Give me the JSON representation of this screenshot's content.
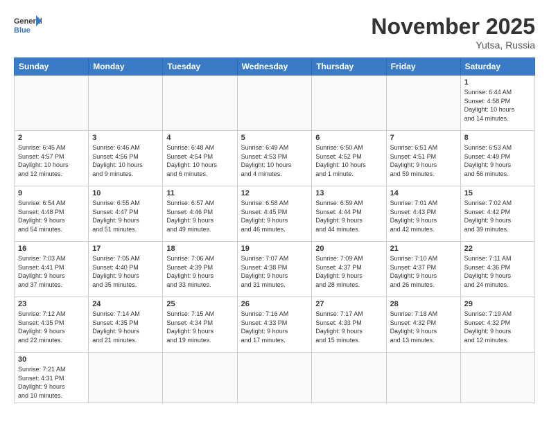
{
  "header": {
    "logo_general": "General",
    "logo_blue": "Blue",
    "month": "November 2025",
    "location": "Yutsa, Russia"
  },
  "days_of_week": [
    "Sunday",
    "Monday",
    "Tuesday",
    "Wednesday",
    "Thursday",
    "Friday",
    "Saturday"
  ],
  "weeks": [
    [
      {
        "day": "",
        "info": ""
      },
      {
        "day": "",
        "info": ""
      },
      {
        "day": "",
        "info": ""
      },
      {
        "day": "",
        "info": ""
      },
      {
        "day": "",
        "info": ""
      },
      {
        "day": "",
        "info": ""
      },
      {
        "day": "1",
        "info": "Sunrise: 6:44 AM\nSunset: 4:58 PM\nDaylight: 10 hours\nand 14 minutes."
      }
    ],
    [
      {
        "day": "2",
        "info": "Sunrise: 6:45 AM\nSunset: 4:57 PM\nDaylight: 10 hours\nand 12 minutes."
      },
      {
        "day": "3",
        "info": "Sunrise: 6:46 AM\nSunset: 4:56 PM\nDaylight: 10 hours\nand 9 minutes."
      },
      {
        "day": "4",
        "info": "Sunrise: 6:48 AM\nSunset: 4:54 PM\nDaylight: 10 hours\nand 6 minutes."
      },
      {
        "day": "5",
        "info": "Sunrise: 6:49 AM\nSunset: 4:53 PM\nDaylight: 10 hours\nand 4 minutes."
      },
      {
        "day": "6",
        "info": "Sunrise: 6:50 AM\nSunset: 4:52 PM\nDaylight: 10 hours\nand 1 minute."
      },
      {
        "day": "7",
        "info": "Sunrise: 6:51 AM\nSunset: 4:51 PM\nDaylight: 9 hours\nand 59 minutes."
      },
      {
        "day": "8",
        "info": "Sunrise: 6:53 AM\nSunset: 4:49 PM\nDaylight: 9 hours\nand 56 minutes."
      }
    ],
    [
      {
        "day": "9",
        "info": "Sunrise: 6:54 AM\nSunset: 4:48 PM\nDaylight: 9 hours\nand 54 minutes."
      },
      {
        "day": "10",
        "info": "Sunrise: 6:55 AM\nSunset: 4:47 PM\nDaylight: 9 hours\nand 51 minutes."
      },
      {
        "day": "11",
        "info": "Sunrise: 6:57 AM\nSunset: 4:46 PM\nDaylight: 9 hours\nand 49 minutes."
      },
      {
        "day": "12",
        "info": "Sunrise: 6:58 AM\nSunset: 4:45 PM\nDaylight: 9 hours\nand 46 minutes."
      },
      {
        "day": "13",
        "info": "Sunrise: 6:59 AM\nSunset: 4:44 PM\nDaylight: 9 hours\nand 44 minutes."
      },
      {
        "day": "14",
        "info": "Sunrise: 7:01 AM\nSunset: 4:43 PM\nDaylight: 9 hours\nand 42 minutes."
      },
      {
        "day": "15",
        "info": "Sunrise: 7:02 AM\nSunset: 4:42 PM\nDaylight: 9 hours\nand 39 minutes."
      }
    ],
    [
      {
        "day": "16",
        "info": "Sunrise: 7:03 AM\nSunset: 4:41 PM\nDaylight: 9 hours\nand 37 minutes."
      },
      {
        "day": "17",
        "info": "Sunrise: 7:05 AM\nSunset: 4:40 PM\nDaylight: 9 hours\nand 35 minutes."
      },
      {
        "day": "18",
        "info": "Sunrise: 7:06 AM\nSunset: 4:39 PM\nDaylight: 9 hours\nand 33 minutes."
      },
      {
        "day": "19",
        "info": "Sunrise: 7:07 AM\nSunset: 4:38 PM\nDaylight: 9 hours\nand 31 minutes."
      },
      {
        "day": "20",
        "info": "Sunrise: 7:09 AM\nSunset: 4:37 PM\nDaylight: 9 hours\nand 28 minutes."
      },
      {
        "day": "21",
        "info": "Sunrise: 7:10 AM\nSunset: 4:37 PM\nDaylight: 9 hours\nand 26 minutes."
      },
      {
        "day": "22",
        "info": "Sunrise: 7:11 AM\nSunset: 4:36 PM\nDaylight: 9 hours\nand 24 minutes."
      }
    ],
    [
      {
        "day": "23",
        "info": "Sunrise: 7:12 AM\nSunset: 4:35 PM\nDaylight: 9 hours\nand 22 minutes."
      },
      {
        "day": "24",
        "info": "Sunrise: 7:14 AM\nSunset: 4:35 PM\nDaylight: 9 hours\nand 21 minutes."
      },
      {
        "day": "25",
        "info": "Sunrise: 7:15 AM\nSunset: 4:34 PM\nDaylight: 9 hours\nand 19 minutes."
      },
      {
        "day": "26",
        "info": "Sunrise: 7:16 AM\nSunset: 4:33 PM\nDaylight: 9 hours\nand 17 minutes."
      },
      {
        "day": "27",
        "info": "Sunrise: 7:17 AM\nSunset: 4:33 PM\nDaylight: 9 hours\nand 15 minutes."
      },
      {
        "day": "28",
        "info": "Sunrise: 7:18 AM\nSunset: 4:32 PM\nDaylight: 9 hours\nand 13 minutes."
      },
      {
        "day": "29",
        "info": "Sunrise: 7:19 AM\nSunset: 4:32 PM\nDaylight: 9 hours\nand 12 minutes."
      }
    ],
    [
      {
        "day": "30",
        "info": "Sunrise: 7:21 AM\nSunset: 4:31 PM\nDaylight: 9 hours\nand 10 minutes."
      },
      {
        "day": "",
        "info": ""
      },
      {
        "day": "",
        "info": ""
      },
      {
        "day": "",
        "info": ""
      },
      {
        "day": "",
        "info": ""
      },
      {
        "day": "",
        "info": ""
      },
      {
        "day": "",
        "info": ""
      }
    ]
  ]
}
